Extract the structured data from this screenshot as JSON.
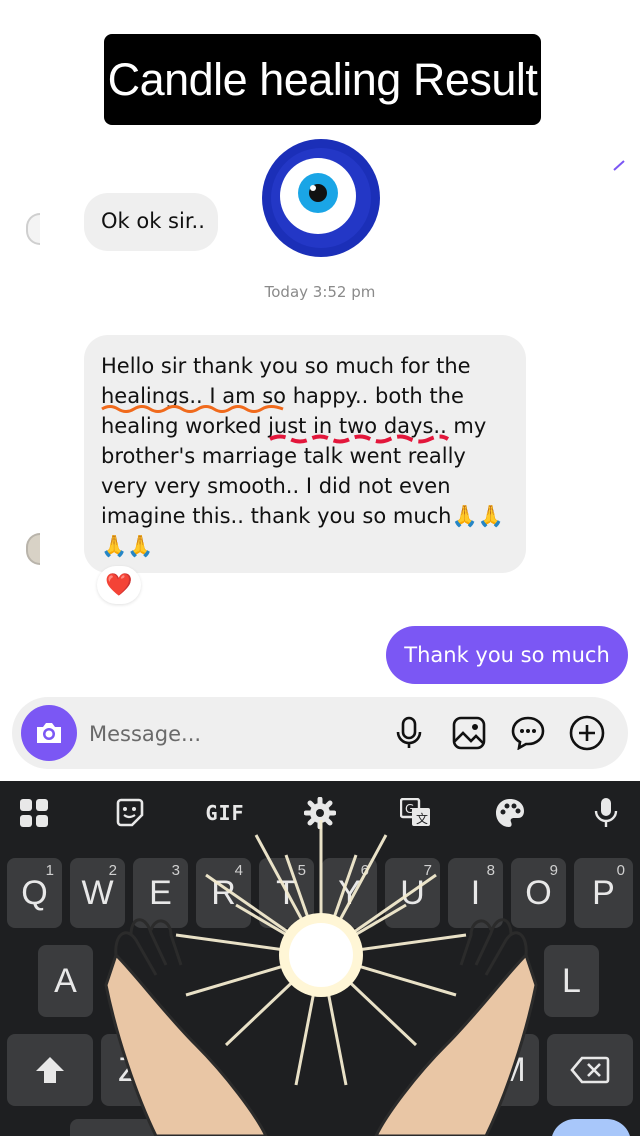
{
  "overlay": {
    "title": "Candle healing Result"
  },
  "chat": {
    "messages": [
      {
        "direction": "incoming",
        "text": "Ok ok sir.."
      },
      {
        "direction": "incoming",
        "text": "Hello sir thank you  so much for the\nhealings.. I am so happy.. both the\nhealing worked just in two days.. my\nbrother's marriage talk went really\nvery very smooth.. I did not even\nimagine this.. thank you so much🙏🙏\n🙏🙏",
        "reaction": "❤️"
      },
      {
        "direction": "outgoing",
        "text": "Thank you so much"
      }
    ],
    "timestamp": "Today 3:52 pm"
  },
  "composer": {
    "placeholder": "Message...",
    "icons": [
      "camera-icon",
      "microphone-icon",
      "image-icon",
      "sticker-icon",
      "add-icon"
    ]
  },
  "keyboard": {
    "toolbar": [
      "apps-grid-icon",
      "sticker-icon",
      "GIF",
      "settings-icon",
      "translate-icon",
      "palette-icon",
      "microphone-icon"
    ],
    "rows": [
      [
        {
          "label": "Q",
          "alt": "1"
        },
        {
          "label": "W",
          "alt": "2"
        },
        {
          "label": "E",
          "alt": "3"
        },
        {
          "label": "R",
          "alt": "4"
        },
        {
          "label": "T",
          "alt": "5"
        },
        {
          "label": "Y",
          "alt": "6"
        },
        {
          "label": "U",
          "alt": "7"
        },
        {
          "label": "I",
          "alt": "8"
        },
        {
          "label": "O",
          "alt": "9"
        },
        {
          "label": "P",
          "alt": "0"
        }
      ],
      [
        {
          "label": "A"
        },
        {
          "label": "L"
        }
      ],
      [
        {
          "label": "Z"
        },
        {
          "label": "M"
        }
      ]
    ]
  },
  "colors": {
    "accent": "#7b57f4",
    "incoming_bubble": "#efefef",
    "keyboard_bg": "#1e1f21",
    "key_bg": "#3b3c3e"
  }
}
